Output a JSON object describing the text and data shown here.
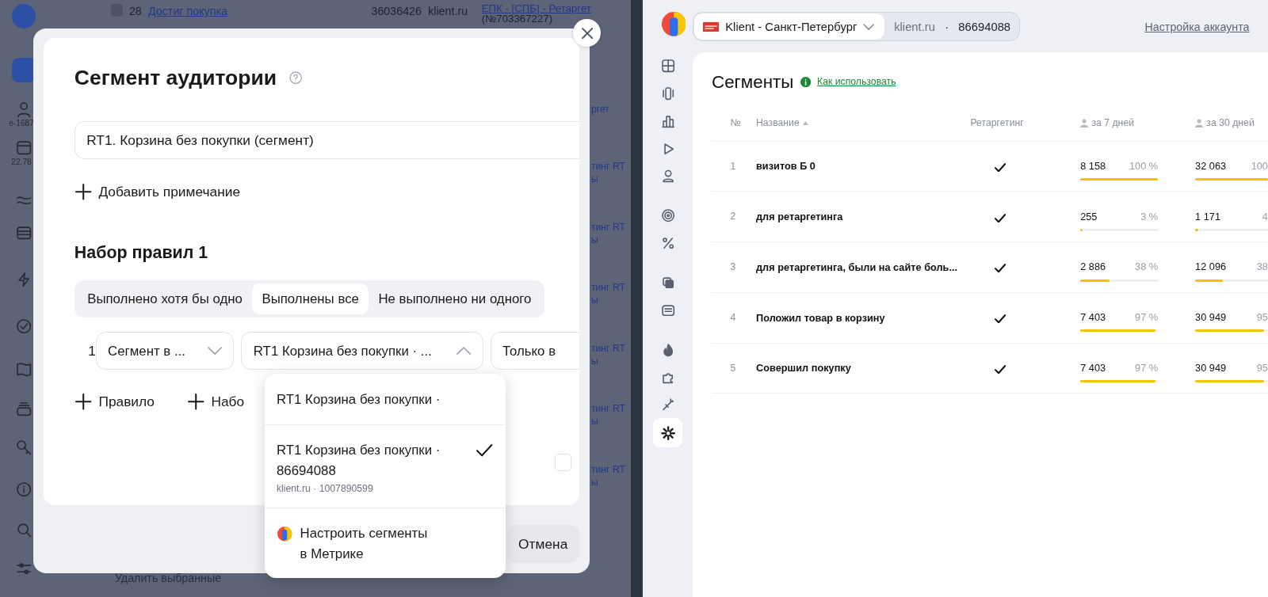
{
  "background_app": {
    "row": {
      "checked": false,
      "number": "28",
      "title": "Достиг покупка",
      "id": "36036426",
      "site": "klient.ru",
      "campaign": "ЕПК - [СПБ] - Ретаргет",
      "campaign_id": "(№703367227)"
    },
    "sidebar_labels": [
      "e-1687",
      "22.78"
    ],
    "edge_fragments": [
      [
        "ргет"
      ],
      [
        "тинг RT",
        "ы"
      ],
      [
        "тинг RT",
        "ы"
      ],
      [
        "тинг RT",
        "ы"
      ],
      [
        "тинг RT",
        "ы"
      ],
      [
        "тинг RT",
        "ы"
      ],
      [
        "тинг RT",
        "ы"
      ]
    ],
    "footer_action": "Удалить выбранные"
  },
  "dialog": {
    "title": "Сегмент аудитории",
    "name_value": "RT1. Корзина без покупки (сегмент)",
    "add_note": "Добавить примечание",
    "rule_set": {
      "title": "Набор правил 1",
      "modes": [
        {
          "label": "Выполнено хотя бы одно",
          "selected": false
        },
        {
          "label": "Выполнены все",
          "selected": true
        },
        {
          "label": "Не выполнено ни одного",
          "selected": false
        }
      ],
      "rules": [
        {
          "number": "1",
          "fields": [
            {
              "value": "Сегмент в ...",
              "expanded": false
            },
            {
              "value": "RT1 Корзина без покупки · ...",
              "expanded": true
            },
            {
              "value": "Только в"
            }
          ]
        }
      ]
    },
    "actions": [
      "Правило",
      "Набо"
    ],
    "checkbox": {
      "checked": false
    },
    "cancel": "Отмена",
    "dropdown": {
      "options": [
        {
          "kind": "option",
          "title": "RT1 Корзина без покупки ·",
          "selected": false
        },
        {
          "kind": "option",
          "title": "RT1 Корзина без покупки · 86694088",
          "subtitle": "klient.ru · 1007890599",
          "selected": true
        },
        {
          "kind": "action",
          "title": "Настроить сегменты в Метрике"
        }
      ]
    }
  },
  "right_app": {
    "account": {
      "name": "Klient - Санкт-Петербург",
      "site": "klient.ru",
      "separator": "·",
      "id": "86694088"
    },
    "settings_link": "Настройка аккаунта",
    "nav_groups": [
      {
        "items": [
          {
            "selected": false
          },
          {
            "selected": false
          },
          {
            "selected": false
          },
          {
            "selected": false
          },
          {
            "selected": false
          }
        ]
      },
      {
        "items": [
          {
            "selected": false
          },
          {
            "selected": false
          }
        ]
      },
      {
        "items": [
          {
            "selected": false
          },
          {
            "selected": false
          }
        ]
      },
      {
        "items": [
          {
            "selected": false
          },
          {
            "selected": false
          },
          {
            "selected": false
          },
          {
            "selected": true
          }
        ]
      }
    ],
    "page": {
      "title": "Сегменты",
      "help_link": "Как использовать",
      "table": {
        "columns": [
          {
            "label": "№",
            "kind": "text",
            "sorted": false
          },
          {
            "label": "Название",
            "kind": "text",
            "sorted": true
          },
          {
            "label": "Ретаргетинг",
            "kind": "text",
            "sorted": false
          },
          {
            "label": "за 7 дней",
            "kind": "count",
            "sorted": false
          },
          {
            "label": "за 30 дней",
            "kind": "count",
            "sorted": false
          }
        ],
        "rows": [
          {
            "number": "1",
            "name": "визитов Б 0",
            "retargeting": true,
            "week": {
              "count": "8 158",
              "share": "100 %",
              "level": 1
            },
            "month": {
              "count": "32 063",
              "share": "100",
              "level": 1
            }
          },
          {
            "number": "2",
            "name": "для ретаргетинга",
            "retargeting": true,
            "week": {
              "count": "255",
              "share": "3 %",
              "level": 0.03
            },
            "month": {
              "count": "1 171",
              "share": "4",
              "level": 0.04
            }
          },
          {
            "number": "3",
            "name": "для ретаргетинга, были на сайте боль...",
            "retargeting": true,
            "week": {
              "count": "2 886",
              "share": "38 %",
              "level": 0.38
            },
            "month": {
              "count": "12 096",
              "share": "38",
              "level": 0.38
            }
          },
          {
            "number": "4",
            "name": "Положил товар в корзину",
            "retargeting": true,
            "week": {
              "count": "7 403",
              "share": "97 %",
              "level": 0.97
            },
            "month": {
              "count": "30 949",
              "share": "95",
              "level": 0.95
            }
          },
          {
            "number": "5",
            "name": "Совершил покупку",
            "retargeting": true,
            "week": {
              "count": "7 403",
              "share": "97 %",
              "level": 0.97
            },
            "month": {
              "count": "30 949",
              "share": "95",
              "level": 0.95
            }
          }
        ]
      }
    }
  }
}
